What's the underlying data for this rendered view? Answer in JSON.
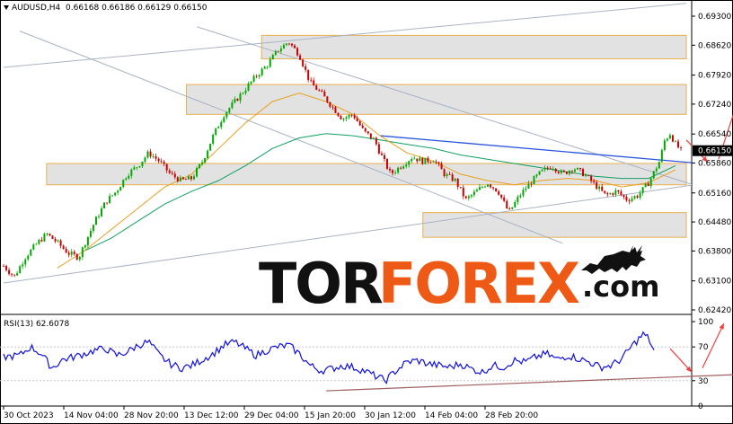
{
  "header": {
    "symbol": "AUDUSD,H4",
    "ohlc": "0.66168 0.66186 0.66129 0.66150"
  },
  "rsi_header": {
    "label": "RSI(13) 62.6078"
  },
  "logo": {
    "tor": "TOR",
    "forex": "FOREX",
    "com": ".com"
  },
  "colors": {
    "bull": "#00aa00",
    "bear": "#cc0000",
    "ma_fast": "#e8a020",
    "ma_slow": "#10a060",
    "trend_blue": "#2a54e0",
    "arrow": "#f04040",
    "rsi": "#1010e0",
    "zone_fill": "#e2e2e2",
    "zone_border": "#e8b050",
    "channel": "#a8b4c4",
    "logo_orange": "#ee5a16"
  },
  "chart_data": [
    {
      "type": "line",
      "title": "AUDUSD,H4",
      "price_axis_ticks": [
        "0.69300",
        "0.68620",
        "0.67920",
        "0.67240",
        "0.66540",
        "0.65860",
        "0.65160",
        "0.64480",
        "0.63800",
        "0.63100",
        "0.62420"
      ],
      "current_price": "0.66150",
      "time_axis_ticks": [
        "30 Oct 2023",
        "14 Nov 04:00",
        "28 Nov 20:00",
        "13 Dec 12:00",
        "29 Dec 04:00",
        "15 Jan 20:00",
        "30 Jan 12:00",
        "14 Feb 04:00",
        "28 Feb 20:00"
      ],
      "ylim": [
        0.6242,
        0.693
      ],
      "series_path": [
        [
          0,
          0.6345
        ],
        [
          2,
          0.632
        ],
        [
          4,
          0.6365
        ],
        [
          6,
          0.6395
        ],
        [
          8,
          0.642
        ],
        [
          10,
          0.64
        ],
        [
          12,
          0.6375
        ],
        [
          14,
          0.6365
        ],
        [
          15,
          0.6395
        ],
        [
          17,
          0.645
        ],
        [
          19,
          0.6495
        ],
        [
          21,
          0.652
        ],
        [
          23,
          0.656
        ],
        [
          25,
          0.658
        ],
        [
          27,
          0.661
        ],
        [
          29,
          0.659
        ],
        [
          31,
          0.656
        ],
        [
          33,
          0.6545
        ],
        [
          35,
          0.655
        ],
        [
          37,
          0.659
        ],
        [
          39,
          0.665
        ],
        [
          41,
          0.67
        ],
        [
          43,
          0.673
        ],
        [
          45,
          0.676
        ],
        [
          47,
          0.679
        ],
        [
          49,
          0.6815
        ],
        [
          51,
          0.685
        ],
        [
          53,
          0.687
        ],
        [
          55,
          0.684
        ],
        [
          57,
          0.6775
        ],
        [
          59,
          0.675
        ],
        [
          61,
          0.672
        ],
        [
          63,
          0.669
        ],
        [
          65,
          0.67
        ],
        [
          67,
          0.666
        ],
        [
          69,
          0.664
        ],
        [
          70,
          0.661
        ],
        [
          72,
          0.656
        ],
        [
          74,
          0.658
        ],
        [
          76,
          0.66
        ],
        [
          78,
          0.659
        ],
        [
          80,
          0.6595
        ],
        [
          82,
          0.656
        ],
        [
          84,
          0.6545
        ],
        [
          86,
          0.65
        ],
        [
          88,
          0.652
        ],
        [
          90,
          0.654
        ],
        [
          92,
          0.652
        ],
        [
          94,
          0.647
        ],
        [
          96,
          0.651
        ],
        [
          98,
          0.654
        ],
        [
          100,
          0.6565
        ],
        [
          102,
          0.658
        ],
        [
          104,
          0.656
        ],
        [
          106,
          0.6575
        ],
        [
          108,
          0.656
        ],
        [
          110,
          0.6535
        ],
        [
          112,
          0.651
        ],
        [
          114,
          0.652
        ],
        [
          116,
          0.65
        ],
        [
          118,
          0.651
        ],
        [
          120,
          0.654
        ],
        [
          122,
          0.659
        ],
        [
          123,
          0.664
        ],
        [
          124,
          0.6655
        ],
        [
          125,
          0.663
        ],
        [
          126,
          0.6615
        ]
      ],
      "ma_fast_path": [
        [
          10,
          0.634
        ],
        [
          15,
          0.638
        ],
        [
          20,
          0.643
        ],
        [
          25,
          0.648
        ],
        [
          30,
          0.653
        ],
        [
          35,
          0.656
        ],
        [
          40,
          0.662
        ],
        [
          45,
          0.668
        ],
        [
          50,
          0.673
        ],
        [
          55,
          0.675
        ],
        [
          60,
          0.673
        ],
        [
          65,
          0.67
        ],
        [
          70,
          0.665
        ],
        [
          75,
          0.661
        ],
        [
          80,
          0.659
        ],
        [
          85,
          0.656
        ],
        [
          90,
          0.6545
        ],
        [
          95,
          0.6535
        ],
        [
          100,
          0.6545
        ],
        [
          105,
          0.655
        ],
        [
          110,
          0.6545
        ],
        [
          115,
          0.653
        ],
        [
          120,
          0.654
        ],
        [
          125,
          0.657
        ]
      ],
      "ma_slow_path": [
        [
          15,
          0.638
        ],
        [
          20,
          0.641
        ],
        [
          25,
          0.645
        ],
        [
          30,
          0.649
        ],
        [
          35,
          0.652
        ],
        [
          40,
          0.6545
        ],
        [
          45,
          0.658
        ],
        [
          50,
          0.662
        ],
        [
          55,
          0.6645
        ],
        [
          60,
          0.6655
        ],
        [
          65,
          0.665
        ],
        [
          70,
          0.664
        ],
        [
          75,
          0.663
        ],
        [
          80,
          0.662
        ],
        [
          85,
          0.6605
        ],
        [
          90,
          0.6595
        ],
        [
          95,
          0.6585
        ],
        [
          100,
          0.6575
        ],
        [
          105,
          0.6565
        ],
        [
          110,
          0.6555
        ],
        [
          115,
          0.655
        ],
        [
          120,
          0.655
        ],
        [
          125,
          0.658
        ]
      ],
      "zones": [
        {
          "x0": 48,
          "x1": 127,
          "y0": 0.683,
          "y1": 0.6885
        },
        {
          "x0": 34,
          "x1": 127,
          "y0": 0.67,
          "y1": 0.677
        },
        {
          "x0": 8,
          "x1": 127,
          "y0": 0.6535,
          "y1": 0.6585
        },
        {
          "x0": 78,
          "x1": 127,
          "y0": 0.6412,
          "y1": 0.647
        }
      ],
      "lines": [
        {
          "name": "channel-upper",
          "x0": 0,
          "y0": 0.681,
          "x1": 127,
          "y1": 0.696,
          "color": "#a8b4c4"
        },
        {
          "name": "channel-lower",
          "x0": 0,
          "y0": 0.6305,
          "x1": 134,
          "y1": 0.6545,
          "color": "#a8b4c4"
        },
        {
          "name": "diag-1",
          "x0": 3,
          "y0": 0.6895,
          "x1": 104,
          "y1": 0.6398,
          "color": "#a8b4c4"
        },
        {
          "name": "diag-2",
          "x0": 36,
          "y0": 0.6905,
          "x1": 147,
          "y1": 0.646,
          "color": "#a8b4c4"
        },
        {
          "name": "trendline",
          "x0": 70,
          "y0": 0.665,
          "x1": 148,
          "y1": 0.6565,
          "color": "#2a54e0"
        }
      ],
      "arrows": [
        {
          "x0": 127,
          "y0": 0.664,
          "x1": 131,
          "y1": 0.6588
        },
        {
          "x0": 133,
          "y0": 0.6595,
          "x1": 138,
          "y1": 0.6785
        }
      ]
    },
    {
      "type": "line",
      "title": "RSI(13) 62.6078",
      "ylim": [
        0,
        100
      ],
      "levels": [
        "100",
        "70",
        "30",
        "0"
      ],
      "series_path": [
        [
          0,
          58
        ],
        [
          3,
          60
        ],
        [
          5,
          70
        ],
        [
          7,
          62
        ],
        [
          9,
          45
        ],
        [
          11,
          55
        ],
        [
          13,
          58
        ],
        [
          15,
          62
        ],
        [
          17,
          66
        ],
        [
          19,
          68
        ],
        [
          21,
          60
        ],
        [
          23,
          64
        ],
        [
          25,
          72
        ],
        [
          27,
          76
        ],
        [
          29,
          60
        ],
        [
          31,
          50
        ],
        [
          33,
          45
        ],
        [
          35,
          48
        ],
        [
          37,
          55
        ],
        [
          39,
          62
        ],
        [
          41,
          72
        ],
        [
          43,
          76
        ],
        [
          45,
          68
        ],
        [
          47,
          60
        ],
        [
          49,
          66
        ],
        [
          51,
          70
        ],
        [
          53,
          72
        ],
        [
          55,
          62
        ],
        [
          57,
          48
        ],
        [
          59,
          42
        ],
        [
          61,
          44
        ],
        [
          63,
          48
        ],
        [
          65,
          46
        ],
        [
          67,
          42
        ],
        [
          69,
          36
        ],
        [
          71,
          30
        ],
        [
          73,
          42
        ],
        [
          75,
          52
        ],
        [
          77,
          54
        ],
        [
          79,
          50
        ],
        [
          81,
          48
        ],
        [
          83,
          46
        ],
        [
          85,
          50
        ],
        [
          87,
          44
        ],
        [
          89,
          40
        ],
        [
          91,
          48
        ],
        [
          93,
          46
        ],
        [
          95,
          54
        ],
        [
          97,
          52
        ],
        [
          99,
          58
        ],
        [
          101,
          62
        ],
        [
          103,
          55
        ],
        [
          105,
          60
        ],
        [
          107,
          56
        ],
        [
          109,
          52
        ],
        [
          111,
          46
        ],
        [
          113,
          48
        ],
        [
          115,
          56
        ],
        [
          117,
          72
        ],
        [
          119,
          85
        ],
        [
          120,
          80
        ],
        [
          121,
          65
        ]
      ],
      "lines": [
        {
          "name": "rsi-support",
          "x0": 60,
          "y0": 18,
          "x1": 147,
          "y1": 40,
          "color": "#a06060"
        }
      ],
      "arrows": [
        {
          "x0": 124,
          "y0": 68,
          "x1": 128,
          "y1": 40
        },
        {
          "x0": 130,
          "y0": 45,
          "x1": 134,
          "y1": 98
        }
      ]
    }
  ]
}
